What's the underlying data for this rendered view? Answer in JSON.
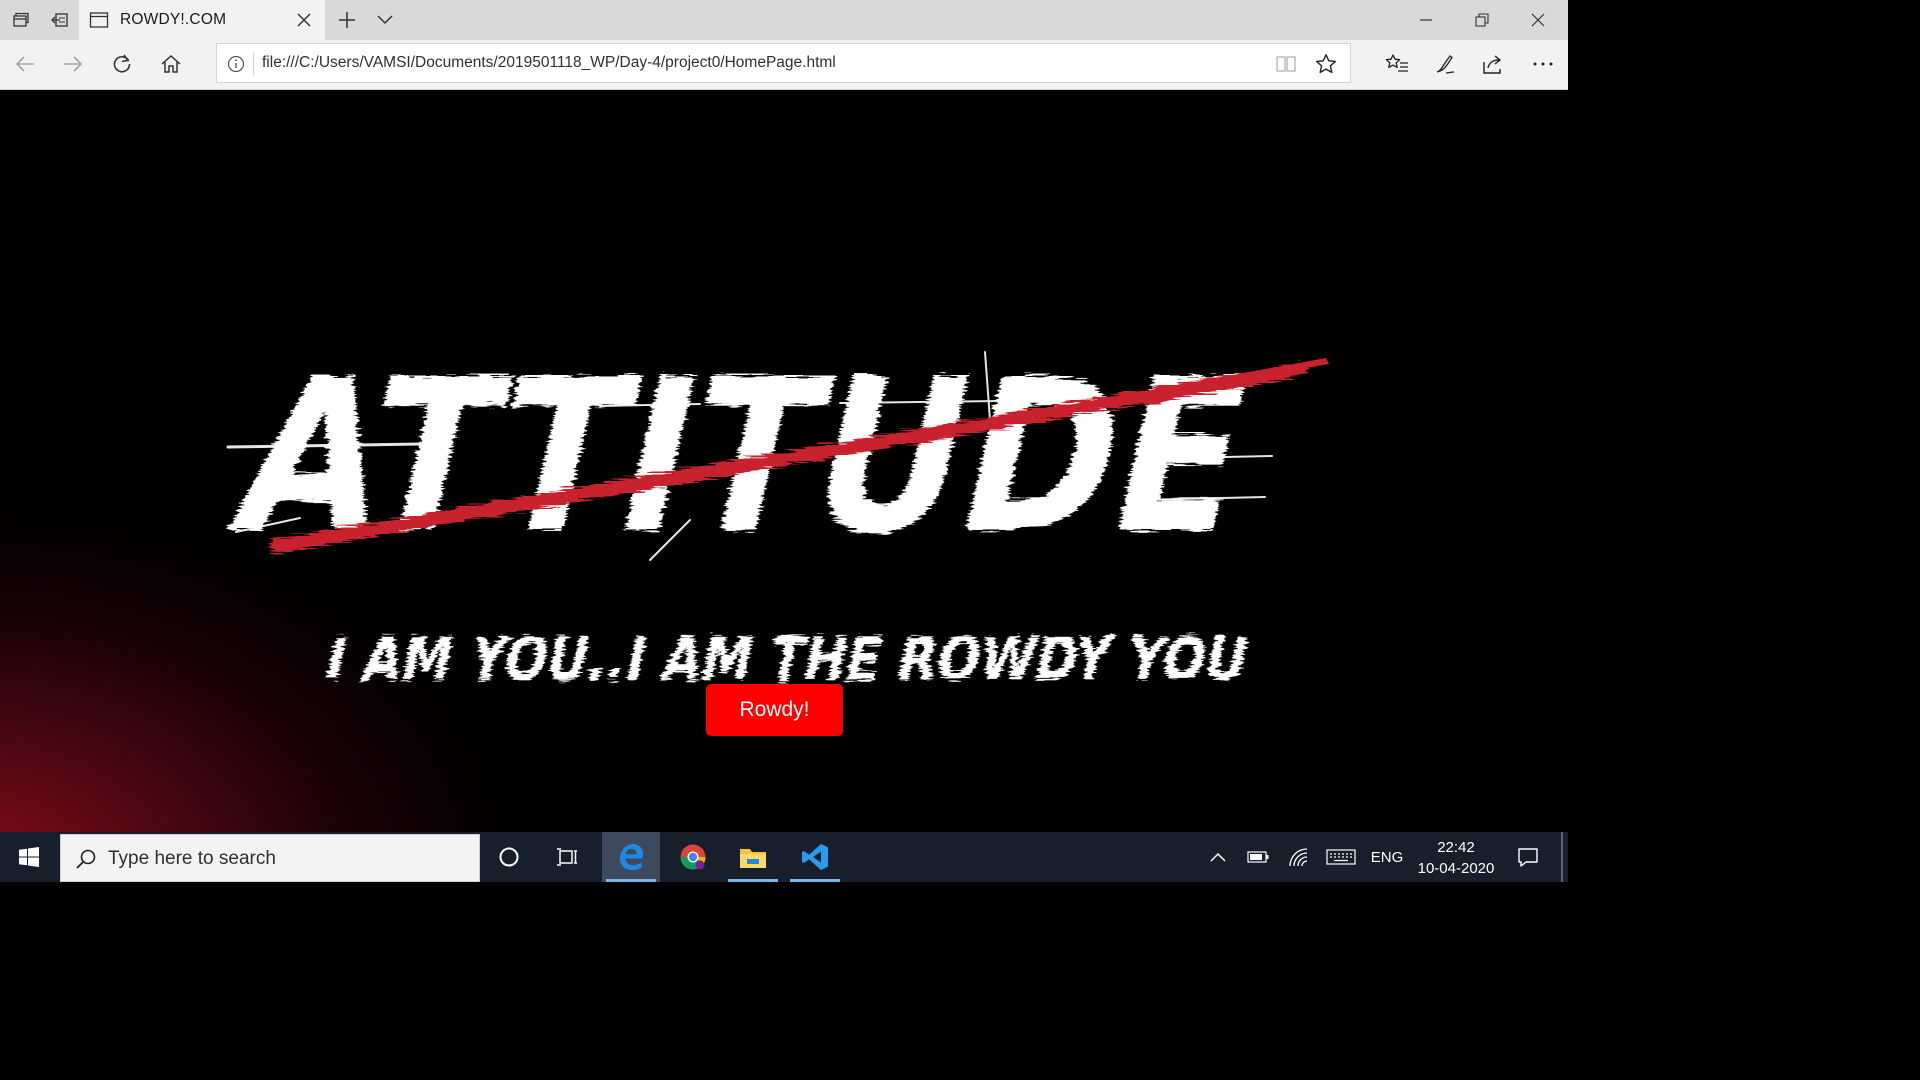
{
  "browser": {
    "tab": {
      "title": "ROWDY!.COM"
    },
    "address_bar": {
      "url": "file:///C:/Users/VAMSI/Documents/2019501118_WP/Day-4/project0/HomePage.html"
    }
  },
  "page": {
    "hero_title": "ATTITUDE",
    "hero_tagline": "I AM YOU..I AM THE ROWDY YOU",
    "button_label": "Rowdy!",
    "colors": {
      "button": "#ff0000",
      "slash": "#c8202e",
      "glow": "#8a0d18"
    }
  },
  "taskbar": {
    "search_placeholder": "Type here to search",
    "language": "ENG",
    "time": "22:42",
    "date": "10-04-2020",
    "apps": [
      "cortana-icon",
      "task-view-icon",
      "edge-icon",
      "chrome-icon",
      "file-explorer-icon",
      "vscode-icon"
    ]
  }
}
